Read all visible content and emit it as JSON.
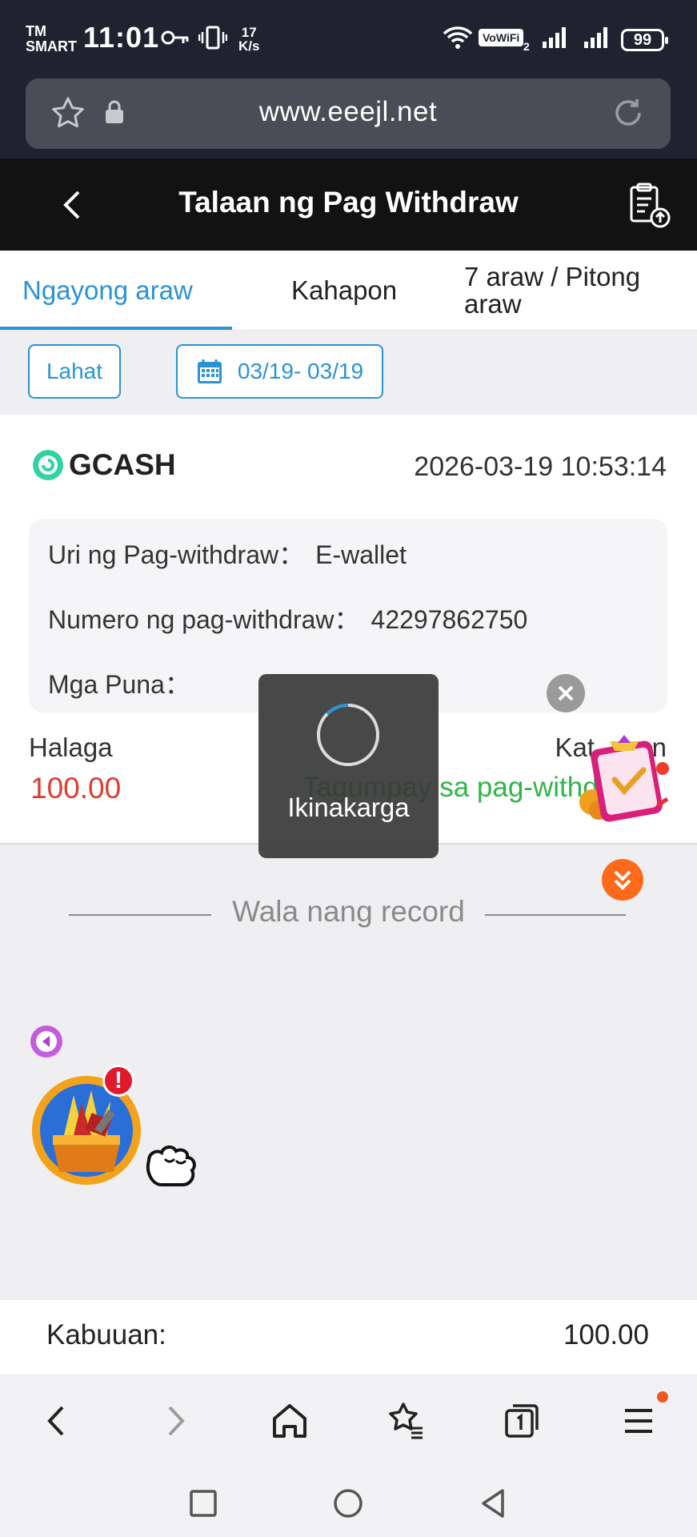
{
  "status_bar": {
    "carrier_line1": "TM",
    "carrier_line2": "SMART",
    "time": "11:01",
    "net_speed_value": "17",
    "net_speed_unit": "K/s",
    "vowifi": "VoWiFi",
    "vowifi_sub": "2",
    "battery": "99",
    "icons": [
      "key-icon",
      "vibrate-icon",
      "wifi-icon",
      "signal-icon",
      "signal-icon",
      "battery-icon"
    ]
  },
  "browser": {
    "url": "www.eeejl.net"
  },
  "header": {
    "title": "Talaan ng Pag Withdraw"
  },
  "tabs": [
    {
      "label": "Ngayong araw",
      "active": true
    },
    {
      "label": "Kahapon",
      "active": false
    },
    {
      "label": "7 araw / Pitong araw",
      "active": false
    }
  ],
  "filters": {
    "all_label": "Lahat",
    "date_range": "03/19- 03/19"
  },
  "record": {
    "method": "GCASH",
    "datetime": "2026-03-19 10:53:14",
    "type_label": "Uri ng Pag-withdraw：",
    "type_value": "E-wallet",
    "number_label": "Numero ng pag-withdraw：",
    "number_value": "42297862750",
    "remarks_label": "Mga Puna：",
    "remarks_value": "",
    "amount_label": "Halaga",
    "amount_value": "100.00",
    "status_label": "Katayuan",
    "status_visible_label": "Kat",
    "status_visible_label_end": "an",
    "status_value": "Tagumpay sa pag-withdraw",
    "status_color": "#2fb548",
    "amount_color": "#e03b2e"
  },
  "empty_text": "Wala nang record",
  "loading": {
    "text": "Ikinakarga"
  },
  "total": {
    "label": "Kabuuan:",
    "value": "100.00"
  },
  "colors": {
    "accent": "#2a93d5",
    "header_bg": "#121212",
    "status_bar_bg": "#1f2330"
  }
}
